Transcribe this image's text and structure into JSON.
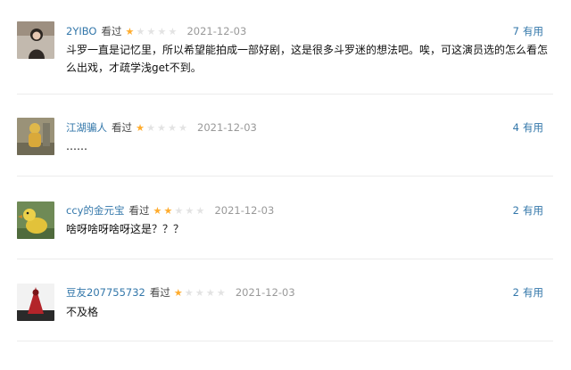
{
  "comments": [
    {
      "user": "2YIBO",
      "status": "看过",
      "rating": 1,
      "date": "2021-12-03",
      "votes": "7",
      "useful_label": "有用",
      "text": "斗罗一直是记忆里，所以希望能拍成一部好剧，这是很多斗罗迷的想法吧。唉，可这演员选的怎么看怎么出戏，才疏学浅get不到。",
      "avatar_icon": "person-portrait-icon"
    },
    {
      "user": "江湖骗人",
      "status": "看过",
      "rating": 1,
      "date": "2021-12-03",
      "votes": "4",
      "useful_label": "有用",
      "text": "……",
      "avatar_icon": "yellow-figure-icon"
    },
    {
      "user": "ccy的金元宝",
      "status": "看过",
      "rating": 2,
      "date": "2021-12-03",
      "votes": "2",
      "useful_label": "有用",
      "text": "啥呀啥呀啥呀这是？？？",
      "avatar_icon": "yellow-duck-icon"
    },
    {
      "user": "豆友207755732",
      "status": "看过",
      "rating": 1,
      "date": "2021-12-03",
      "votes": "2",
      "useful_label": "有用",
      "text": "不及格",
      "avatar_icon": "red-cloak-icon"
    }
  ],
  "colors": {
    "link": "#3377aa",
    "star_on": "#ffac2d",
    "star_off": "#e3e3e3",
    "date": "#999999"
  }
}
